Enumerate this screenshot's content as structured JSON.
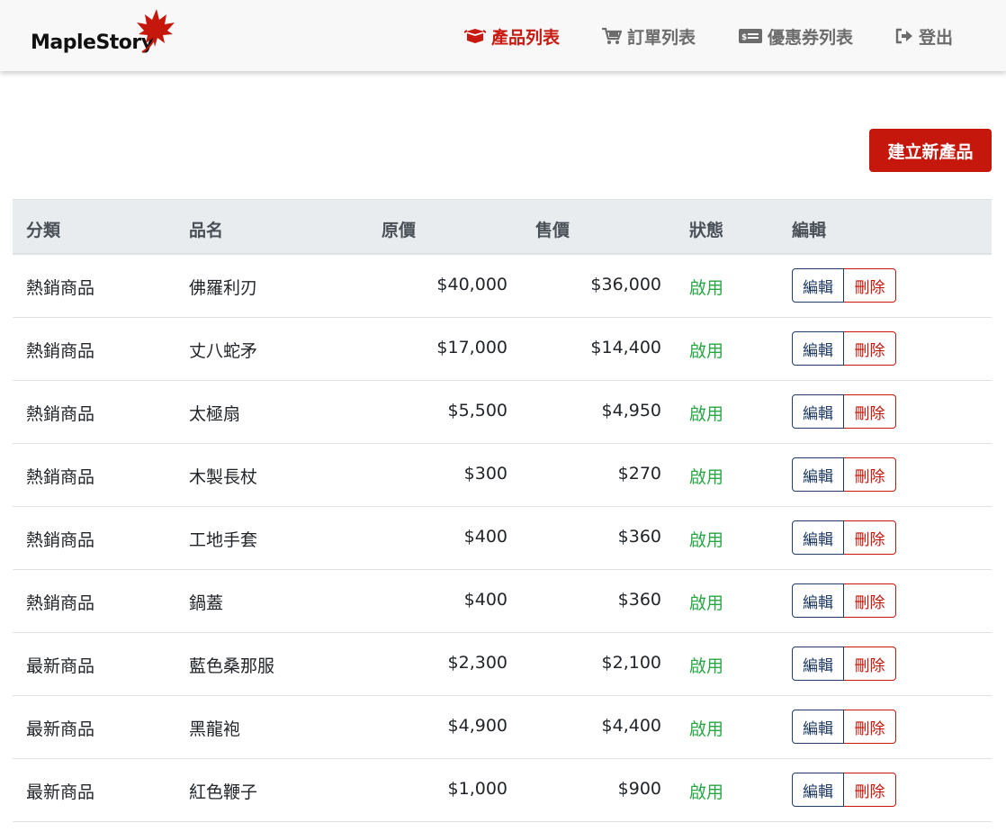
{
  "brand": {
    "name": "MapleStory"
  },
  "nav": {
    "items": [
      {
        "label": "產品列表",
        "icon": "box-open-icon",
        "active": true
      },
      {
        "label": "訂單列表",
        "icon": "cart-icon",
        "active": false
      },
      {
        "label": "優惠券列表",
        "icon": "coupon-icon",
        "active": false
      },
      {
        "label": "登出",
        "icon": "logout-icon",
        "active": false
      }
    ]
  },
  "toolbar": {
    "create_label": "建立新產品"
  },
  "table": {
    "headers": [
      "分類",
      "品名",
      "原價",
      "售價",
      "狀態",
      "編輯"
    ],
    "rows": [
      {
        "category": "熱銷商品",
        "name": "佛羅利刃",
        "origin_price": "$40,000",
        "price": "$36,000",
        "status": "啟用",
        "edit": "編輯",
        "delete": "刪除"
      },
      {
        "category": "熱銷商品",
        "name": "丈八蛇矛",
        "origin_price": "$17,000",
        "price": "$14,400",
        "status": "啟用",
        "edit": "編輯",
        "delete": "刪除"
      },
      {
        "category": "熱銷商品",
        "name": "太極扇",
        "origin_price": "$5,500",
        "price": "$4,950",
        "status": "啟用",
        "edit": "編輯",
        "delete": "刪除"
      },
      {
        "category": "熱銷商品",
        "name": "木製長杖",
        "origin_price": "$300",
        "price": "$270",
        "status": "啟用",
        "edit": "編輯",
        "delete": "刪除"
      },
      {
        "category": "熱銷商品",
        "name": "工地手套",
        "origin_price": "$400",
        "price": "$360",
        "status": "啟用",
        "edit": "編輯",
        "delete": "刪除"
      },
      {
        "category": "熱銷商品",
        "name": "鍋蓋",
        "origin_price": "$400",
        "price": "$360",
        "status": "啟用",
        "edit": "編輯",
        "delete": "刪除"
      },
      {
        "category": "最新商品",
        "name": "藍色桑那服",
        "origin_price": "$2,300",
        "price": "$2,100",
        "status": "啟用",
        "edit": "編輯",
        "delete": "刪除"
      },
      {
        "category": "最新商品",
        "name": "黑龍袍",
        "origin_price": "$4,900",
        "price": "$4,400",
        "status": "啟用",
        "edit": "編輯",
        "delete": "刪除"
      },
      {
        "category": "最新商品",
        "name": "紅色鞭子",
        "origin_price": "$1,000",
        "price": "$900",
        "status": "啟用",
        "edit": "編輯",
        "delete": "刪除"
      }
    ]
  },
  "colors": {
    "brand_red": "#c5170c",
    "nav_gray": "#6c6c6c",
    "status_green": "#28a745",
    "edit_blue": "#1f3b66"
  }
}
